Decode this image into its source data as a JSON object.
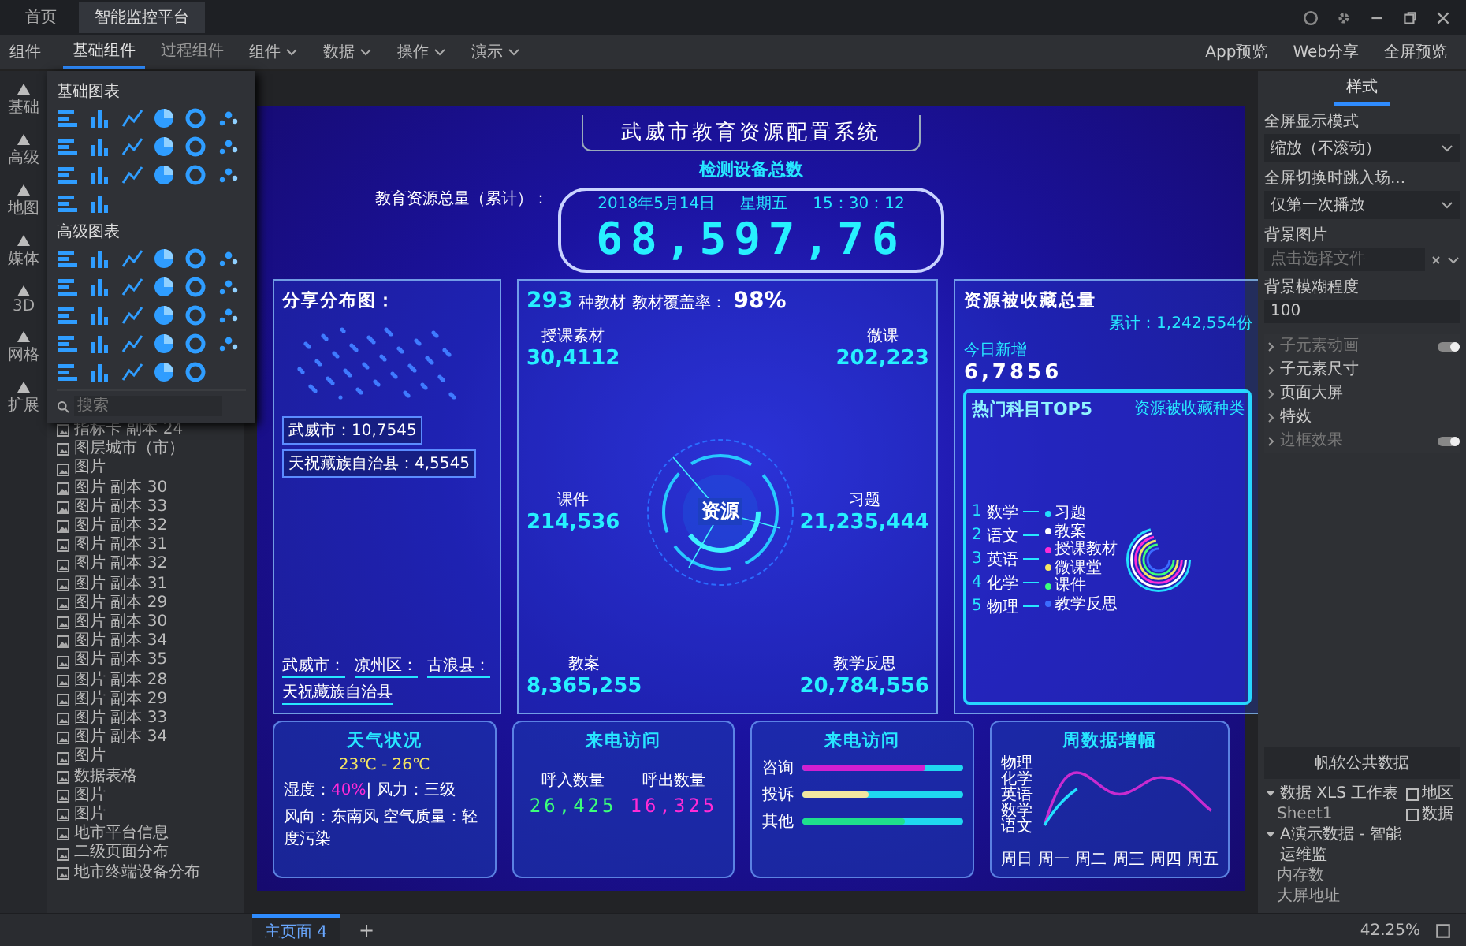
{
  "window": {
    "tabs": [
      {
        "label": "首页",
        "selected": false
      },
      {
        "label": "智能监控平台",
        "selected": true
      }
    ]
  },
  "toolbar": {
    "section_label": "组件",
    "tabs": [
      {
        "label": "基础组件",
        "selected": true
      },
      {
        "label": "过程组件",
        "selected": false
      }
    ],
    "menus": [
      "组件",
      "数据",
      "操作",
      "演示"
    ],
    "actions": [
      "App预览",
      "Web分享",
      "全屏预览"
    ]
  },
  "rail": [
    {
      "label": "基础"
    },
    {
      "label": "高级"
    },
    {
      "label": "地图"
    },
    {
      "label": "媒体"
    },
    {
      "label": "3D"
    },
    {
      "label": "网格"
    },
    {
      "label": "扩展"
    }
  ],
  "gallery": {
    "sections": [
      {
        "title": "基础图表"
      },
      {
        "title": "高级图表"
      }
    ],
    "search_placeholder": "搜索"
  },
  "layers": [
    "指标卡 副本 24",
    "图层城市（市）",
    "图片",
    "图片 副本 30",
    "图片 副本 33",
    "图片 副本 32",
    "图片 副本 31",
    "图片 副本 32",
    "图片 副本 31",
    "图片 副本 29",
    "图片 副本 30",
    "图片 副本 34",
    "图片 副本 35",
    "图片 副本 28",
    "图片 副本 29",
    "图片 副本 33",
    "图片 副本 34",
    "图片",
    "数据表格",
    "图片",
    "图片",
    "地市平台信息",
    "二级页面分布",
    "地市终端设备分布"
  ],
  "dashboard": {
    "title": "武威市教育资源配置系统",
    "subtitle": "检测设备总数",
    "total_label": "教育资源总量（累计）：",
    "date": "2018年5月14日",
    "weekday": "星期五",
    "time": "15：30：12",
    "total": "68,597,76",
    "share": {
      "title": "分享分布图：",
      "tags": [
        "武威市：10,7545",
        "天祝藏族自治县：4,5545"
      ],
      "labels": [
        "武威市：",
        "凉州区：",
        "古浪县：",
        "天祝藏族自治县"
      ]
    },
    "resources": {
      "count": "293",
      "count_unit": "种教材",
      "coverage_label": "教材覆盖率：",
      "coverage": "98%",
      "center": "资源",
      "left": [
        {
          "label": "授课素材",
          "value": "30,4112"
        },
        {
          "label": "课件",
          "value": "214,536"
        },
        {
          "label": "教案",
          "value": "8,365,255"
        }
      ],
      "right": [
        {
          "label": "微课",
          "value": "202,223"
        },
        {
          "label": "习题",
          "value": "21,235,444"
        },
        {
          "label": "教学反思",
          "value": "20,784,556"
        }
      ]
    },
    "favorites": {
      "title": "资源被收藏总量",
      "total": "累计：1,242,554份",
      "new_label": "今日新增",
      "new_value": "6,7856",
      "top_title": "热门科目TOP5",
      "kinds_title": "资源被收藏种类",
      "top": [
        {
          "rank": "1",
          "name": "数学"
        },
        {
          "rank": "2",
          "name": "语文"
        },
        {
          "rank": "3",
          "name": "英语"
        },
        {
          "rank": "4",
          "name": "化学"
        },
        {
          "rank": "5",
          "name": "物理"
        }
      ],
      "legend": [
        {
          "label": "习题",
          "color": "#22e0ff"
        },
        {
          "label": "教案",
          "color": "#ffffff"
        },
        {
          "label": "授课教材",
          "color": "#ff2bd6"
        },
        {
          "label": "微课堂",
          "color": "#f5e663"
        },
        {
          "label": "课件",
          "color": "#3cff7a"
        },
        {
          "label": "教学反思",
          "color": "#3b6cff"
        }
      ]
    },
    "weather": {
      "title": "天气状况",
      "temp": "23℃ - 26℃",
      "humidity_label": "湿度：",
      "humidity": "40%",
      "wind": "| 风力：三级",
      "air": "风向：东南风 空气质量：轻度污染"
    },
    "calls": {
      "title": "来电访问",
      "stats": [
        {
          "label": "呼入数量",
          "value": "26,425",
          "color": "#3cff7a"
        },
        {
          "label": "呼出数量",
          "value": "16,325",
          "color": "#ff2bd6"
        }
      ]
    },
    "call_types": {
      "title": "来电访问",
      "bars": [
        {
          "label": "咨询",
          "level": 0.76,
          "color": "#d21fd0"
        },
        {
          "label": "投诉",
          "level": 0.41,
          "color": "#f3e6a0"
        },
        {
          "label": "其他",
          "level": 0.64,
          "color": "#1fe08c"
        }
      ]
    },
    "weekly": {
      "title": "周数据增幅",
      "subjects": [
        "物理",
        "化学",
        "英语",
        "数学",
        "语文"
      ],
      "days": [
        "周日",
        "周一",
        "周二",
        "周三",
        "周四",
        "周五"
      ]
    }
  },
  "right_panel": {
    "tab": "样式",
    "fields": [
      {
        "label": "全屏显示模式",
        "kind": "select",
        "value": "缩放（不滚动）"
      },
      {
        "label": "全屏切换时跳入场...",
        "kind": "select",
        "value": "仅第一次播放"
      },
      {
        "label": "背景图片",
        "kind": "file",
        "placeholder": "点击选择文件"
      },
      {
        "label": "背景模糊程度",
        "kind": "input",
        "value": "100"
      }
    ],
    "sections": [
      {
        "label": "子元素动画",
        "kind": "toggle",
        "disabled": true,
        "on": true
      },
      {
        "label": "子元素尺寸",
        "kind": "group",
        "disabled": false
      },
      {
        "label": "页面大屏",
        "kind": "group",
        "disabled": false
      },
      {
        "label": "特效",
        "kind": "group",
        "disabled": false
      },
      {
        "label": "边框效果",
        "kind": "toggle",
        "disabled": true,
        "on": true
      }
    ],
    "data_title": "帆软公共数据",
    "tree": [
      {
        "label": "数据 XLS 工作表",
        "expanded": true,
        "children": [
          {
            "label": "Sheet1"
          }
        ]
      },
      {
        "label": "A演示数据 - 智能运维监",
        "expanded": true,
        "children": [
          {
            "label": "内存数"
          },
          {
            "label": "大屏地址"
          }
        ]
      }
    ],
    "columns": [
      {
        "label": "地区"
      },
      {
        "label": "数据"
      }
    ]
  },
  "status_bar": {
    "pages": [
      {
        "label": "主页面 4",
        "selected": true
      }
    ],
    "add": "+",
    "zoom": "42.25%"
  }
}
